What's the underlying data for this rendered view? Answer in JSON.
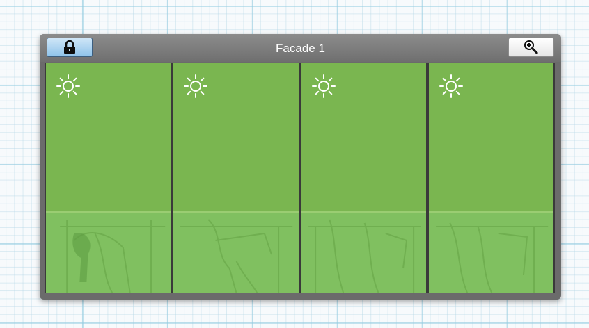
{
  "panel": {
    "title": "Facade 1",
    "lock_button": {
      "icon": "lock-icon"
    },
    "zoom_button": {
      "icon": "zoom-in-icon"
    }
  },
  "panes": [
    {
      "icon": "sun-icon"
    },
    {
      "icon": "sun-icon"
    },
    {
      "icon": "sun-icon"
    },
    {
      "icon": "sun-icon"
    }
  ],
  "colors": {
    "pane_green": "#7ab650",
    "lower_green": "#80c060",
    "frame": "#3a3a3a",
    "titlebar": "#777777",
    "lock_button_blue": "#8fc3ea"
  }
}
